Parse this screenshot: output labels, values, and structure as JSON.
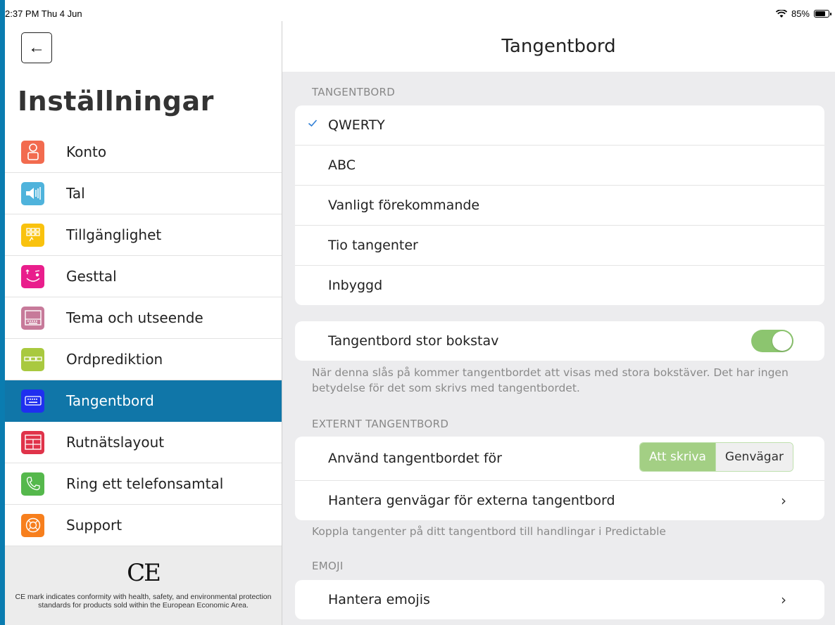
{
  "status_bar": {
    "time": "2:37 PM  Thu 4 Jun",
    "battery_percent": "85%",
    "battery_level": 0.85,
    "wifi_icon": "wifi-icon"
  },
  "sidebar": {
    "back_icon": "←",
    "title": "Inställningar",
    "items": [
      {
        "label": "Konto",
        "icon": "person-icon",
        "color": "#f26b4f"
      },
      {
        "label": "Tal",
        "icon": "speaker-icon",
        "color": "#4fb3dc"
      },
      {
        "label": "Tillgänglighet",
        "icon": "grid-icon",
        "color": "#f9c20e"
      },
      {
        "label": "Gesttal",
        "icon": "gesture-face-icon",
        "color": "#e91e8c"
      },
      {
        "label": "Tema och utseende",
        "icon": "theme-icon",
        "color": "#c77a9a"
      },
      {
        "label": "Ordprediktion",
        "icon": "prediction-icon",
        "color": "#a9c93f"
      },
      {
        "label": "Tangentbord",
        "icon": "keyboard-icon",
        "color": "#1f2ff0"
      },
      {
        "label": "Rutnätslayout",
        "icon": "layout-icon",
        "color": "#e0334a"
      },
      {
        "label": "Ring ett telefonsamtal",
        "icon": "phone-icon",
        "color": "#55b84c"
      },
      {
        "label": "Support",
        "icon": "lifebuoy-icon",
        "color": "#f77f1d"
      }
    ],
    "ce_mark": "CE",
    "ce_text": "CE mark indicates conformity with health, safety, and environmental protection standards for products sold within the European Economic Area."
  },
  "main": {
    "title": "Tangentbord",
    "keyboard_section": {
      "header": "TANGENTBORD",
      "options": [
        "QWERTY",
        "ABC",
        "Vanligt förekommande",
        "Tio tangenter",
        "Inbyggd"
      ],
      "selected": "QWERTY"
    },
    "capital": {
      "label": "Tangentbord stor bokstav",
      "enabled": true,
      "footnote": "När denna slås på kommer tangentbordet att visas med stora bokstäver. Det har ingen betydelse för det som skrivs med tangentbordet."
    },
    "external_section": {
      "header": "EXTERNT TANGENTBORD",
      "use_label": "Använd tangentbordet för",
      "segments": [
        "Att skriva",
        "Genvägar"
      ],
      "selected_segment": "Att skriva",
      "manage_label": "Hantera genvägar för externa tangentbord",
      "footnote": "Koppla tangenter på ditt tangentbord till handlingar i Predictable"
    },
    "emoji_section": {
      "header": "EMOJI",
      "manage_label": "Hantera emojis"
    },
    "chevron": "›"
  }
}
